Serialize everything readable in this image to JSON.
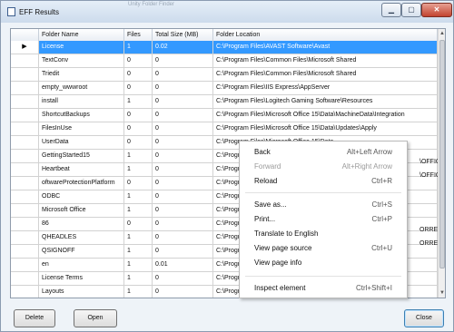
{
  "window": {
    "title": "EFF Results",
    "ghost_title": "Unity Folder Finder",
    "min_glyph": "▁",
    "max_glyph": "▢",
    "close_glyph": "✕"
  },
  "grid": {
    "columns": [
      "",
      "Folder Name",
      "Files",
      "Total Size (MB)",
      "Folder Location"
    ],
    "row_marker": "▶",
    "rows": [
      [
        "License",
        "1",
        "0.02",
        "C:\\Program Files\\AVAST Software\\Avast"
      ],
      [
        "TextConv",
        "0",
        "0",
        "C:\\Program Files\\Common Files\\Microsoft Shared"
      ],
      [
        "Triedit",
        "0",
        "0",
        "C:\\Program Files\\Common Files\\Microsoft Shared"
      ],
      [
        "empty_wwwroot",
        "0",
        "0",
        "C:\\Program Files\\IIS Express\\AppServer"
      ],
      [
        "install",
        "1",
        "0",
        "C:\\Program Files\\Logitech Gaming Software\\Resources"
      ],
      [
        "ShortcutBackups",
        "0",
        "0",
        "C:\\Program Files\\Microsoft Office 15\\Data\\MachineData\\Integration"
      ],
      [
        "FilesInUse",
        "0",
        "0",
        "C:\\Program Files\\Microsoft Office 15\\Data\\Updates\\Apply"
      ],
      [
        "UserData",
        "0",
        "0",
        "C:\\Program Files\\Microsoft Office 15\\Data"
      ],
      [
        "GettingStarted15",
        "1",
        "0",
        "C:\\Program"
      ],
      [
        "Heartbeat",
        "1",
        "0",
        "C:\\Program"
      ],
      [
        "oftwareProtectionPlatform",
        "0",
        "0",
        "C:\\Program"
      ],
      [
        "ODBC",
        "1",
        "0",
        "C:\\Program"
      ],
      [
        "Microsoft Office",
        "1",
        "0",
        "C:\\Program"
      ],
      [
        "86",
        "0",
        "0",
        "C:\\Program"
      ],
      [
        "QHEADLES",
        "1",
        "0",
        "C:\\Program"
      ],
      [
        "QSIGNOFF",
        "1",
        "0",
        "C:\\Program"
      ],
      [
        "en",
        "1",
        "0.01",
        "C:\\Program"
      ],
      [
        "License Terms",
        "1",
        "0",
        "C:\\Program"
      ],
      [
        "Layouts",
        "1",
        "0",
        "C:\\Program"
      ],
      [
        "Clock",
        "1",
        "0",
        "C:\\Program"
      ],
      [
        "",
        "",
        "",
        ""
      ]
    ],
    "overflow_right": {
      "heartbeat": "\\OFFICE",
      "swpp": "\\OFFICE",
      "qheadles": "ORREP",
      "qsignoff": "ORREP"
    }
  },
  "scrollbar": {
    "up": "▲",
    "down": "▼",
    "grip": "≡"
  },
  "context_menu": {
    "items": [
      {
        "label": "Back",
        "shortcut": "Alt+Left Arrow",
        "disabled": false
      },
      {
        "label": "Forward",
        "shortcut": "Alt+Right Arrow",
        "disabled": true
      },
      {
        "label": "Reload",
        "shortcut": "Ctrl+R",
        "disabled": false
      },
      {
        "label": "Save as...",
        "shortcut": "Ctrl+S",
        "disabled": false
      },
      {
        "label": "Print...",
        "shortcut": "Ctrl+P",
        "disabled": false
      },
      {
        "label": "Translate to English",
        "shortcut": "",
        "disabled": false
      },
      {
        "label": "View page source",
        "shortcut": "Ctrl+U",
        "disabled": false
      },
      {
        "label": "View page info",
        "shortcut": "",
        "disabled": false
      },
      {
        "label": "Inspect element",
        "shortcut": "Ctrl+Shift+I",
        "disabled": false
      }
    ]
  },
  "buttons": {
    "delete": "Delete",
    "open": "Open",
    "close": "Close"
  },
  "colors": {
    "selection": "#3399ff",
    "close_button": "#c2432f"
  }
}
